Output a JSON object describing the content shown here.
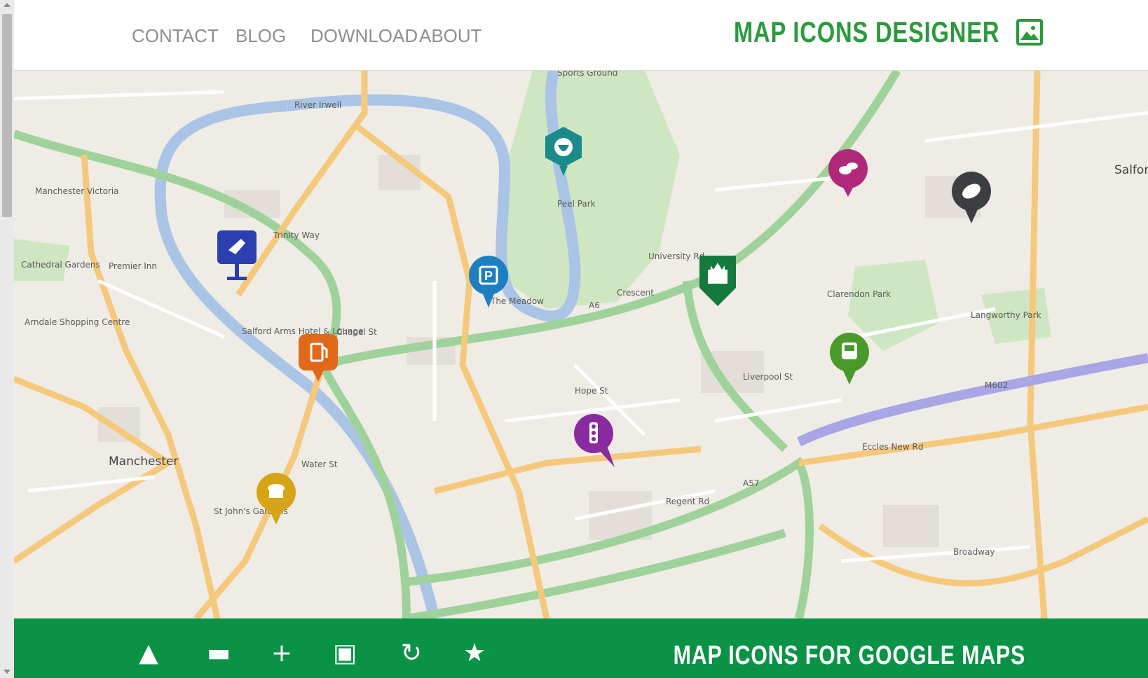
{
  "brand": {
    "title": "MAP ICONS DESIGNER",
    "icon": "map-picture-icon",
    "color": "#2a9a3c"
  },
  "nav": {
    "items": [
      "CONTACT",
      "BLOG",
      "DOWNLOAD",
      "ABOUT"
    ]
  },
  "footer": {
    "title": "MAP ICONS FOR GOOGLE MAPS",
    "color": "#0a9246"
  },
  "map_labels": {
    "city": "Manchester",
    "victoria": "Manchester Victoria",
    "cathedral": "Cathedral Gardens",
    "arndale": "Arndale Shopping Centre",
    "peel_park": "Peel Park",
    "meadow": "The Meadow",
    "clarendon": "Clarendon Park",
    "langworthy": "Langworthy Park",
    "st_johns": "St John's Gardens",
    "river_irwell": "River Irwell",
    "salford": "Salford",
    "sports_ground": "Sports Ground",
    "salford_arms": "Salford Arms Hotel & Lounge",
    "premier_inn": "Premier Inn",
    "m602": "M602",
    "a6": "A6",
    "a57": "A57",
    "chapel_st": "Chapel St",
    "regent_rd": "Regent Rd",
    "liverpool_st": "Liverpool St",
    "broadway": "Broadway",
    "eccles_new_rd": "Eccles New Rd",
    "crescent": "Crescent",
    "trinity_way": "Trinity Way",
    "water_st": "Water St",
    "hope_st": "Hope St",
    "university_rd": "University Rd"
  },
  "markers": [
    {
      "name": "strawberry-marker",
      "icon": "strawberry-icon",
      "color": "#1a8a8a"
    },
    {
      "name": "sushi-marker",
      "icon": "sushi-icon",
      "color": "#b0287a"
    },
    {
      "name": "football-marker",
      "icon": "american-football-icon",
      "color": "#3c3f42"
    },
    {
      "name": "meat-marker",
      "icon": "ham-icon",
      "color": "#2c3fb0"
    },
    {
      "name": "parking-marker",
      "icon": "parking-icon",
      "color": "#1d7fc0"
    },
    {
      "name": "castle-marker",
      "icon": "castle-icon",
      "color": "#137a3c"
    },
    {
      "name": "gas-station-marker",
      "icon": "gas-station-icon",
      "color": "#e06a1a"
    },
    {
      "name": "train-marker",
      "icon": "train-icon",
      "color": "#4a9a2a"
    },
    {
      "name": "traffic-light-marker",
      "icon": "traffic-light-icon",
      "color": "#8a2aa0"
    },
    {
      "name": "bakery-marker",
      "icon": "cupcake-icon",
      "color": "#d6a414"
    }
  ]
}
